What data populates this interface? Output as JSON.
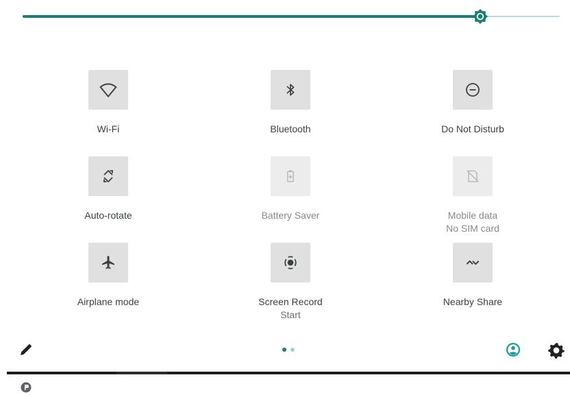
{
  "brightness": {
    "level": 0.86,
    "active_color": "#1a7e73",
    "rest_color": "#b9dcd8"
  },
  "tiles": [
    {
      "label": "Wi-Fi",
      "sub": "",
      "icon": "wifi-icon",
      "enabled": true
    },
    {
      "label": "Bluetooth",
      "sub": "",
      "icon": "bluetooth-icon",
      "enabled": true
    },
    {
      "label": "Do Not Disturb",
      "sub": "",
      "icon": "do-not-disturb-icon",
      "enabled": true
    },
    {
      "label": "Auto-rotate",
      "sub": "",
      "icon": "auto-rotate-icon",
      "enabled": true
    },
    {
      "label": "Battery Saver",
      "sub": "",
      "icon": "battery-saver-icon",
      "enabled": false
    },
    {
      "label": "Mobile data",
      "sub": "No SIM card",
      "icon": "mobile-data-icon",
      "enabled": false
    },
    {
      "label": "Airplane mode",
      "sub": "",
      "icon": "airplane-icon",
      "enabled": true
    },
    {
      "label": "Screen Record",
      "sub": "Start",
      "icon": "screen-record-icon",
      "enabled": true
    },
    {
      "label": "Nearby Share",
      "sub": "",
      "icon": "nearby-share-icon",
      "enabled": true
    }
  ],
  "pager": {
    "pages": 2,
    "current": 1
  },
  "footer": {
    "edit_icon": "pencil-icon",
    "user_icon": "user-account-icon",
    "settings_icon": "gear-icon"
  },
  "colors": {
    "accent": "#1a7e73",
    "tile_bg": "#e0e0e0"
  }
}
